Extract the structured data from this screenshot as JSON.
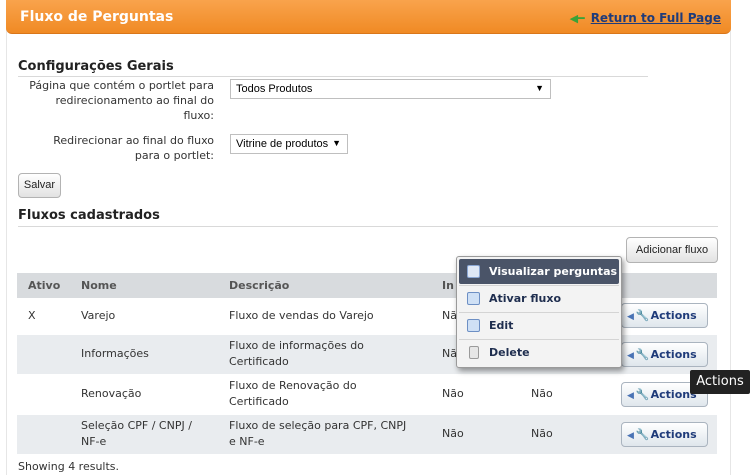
{
  "header": {
    "title": "Fluxo de Perguntas",
    "back_link": "Return to Full Page",
    "back_icon": "green-arrow-left-icon"
  },
  "general": {
    "title": "Configurações Gerais",
    "field1_label_lines": [
      "Página que contém o portlet para",
      "redirecionamento ao final do",
      "fluxo:"
    ],
    "field1_value": "Todos Produtos",
    "field2_label_lines": [
      "Redirecionar ao final do fluxo",
      "para o portlet:"
    ],
    "field2_value": "Vitrine de produtos",
    "save_label": "Salvar"
  },
  "flows": {
    "title": "Fluxos cadastrados",
    "add_label": "Adicionar fluxo",
    "columns": [
      "Ativo",
      "Nome",
      "Descrição",
      "In",
      ""
    ],
    "rows": [
      {
        "ativo": "X",
        "nome": [
          "Varejo"
        ],
        "descricao": [
          "Fluxo de vendas do Varejo"
        ],
        "c4": "Não",
        "c5": "",
        "action": "Actions"
      },
      {
        "ativo": "",
        "nome": [
          "Informações"
        ],
        "descricao": [
          "Fluxo de informações do",
          "Certificado"
        ],
        "c4": "Não",
        "c5": "",
        "action": "Actions"
      },
      {
        "ativo": "",
        "nome": [
          "Renovação"
        ],
        "descricao": [
          "Fluxo de Renovação do",
          "Certificado"
        ],
        "c4": "Não",
        "c5": "Não",
        "action": "Actions"
      },
      {
        "ativo": "",
        "nome": [
          "Seleção CPF / CNPJ /",
          "NF-e"
        ],
        "descricao": [
          "Fluxo de seleção para CPF, CNPJ",
          "e NF-e"
        ],
        "c4": "Não",
        "c5": "Não",
        "action": "Actions"
      }
    ],
    "results_text": "Showing 4 results."
  },
  "menu": {
    "items": [
      {
        "label": "Visualizar perguntas",
        "icon": "view-questions-icon",
        "active": true
      },
      {
        "label": "Ativar fluxo",
        "icon": "activate-icon",
        "active": false
      },
      {
        "label": "Edit",
        "icon": "edit-icon",
        "active": false
      },
      {
        "label": "Delete",
        "icon": "trash-icon",
        "active": false
      }
    ]
  },
  "tooltip": "Actions",
  "colors": {
    "header_orange": "#f08a24",
    "link_blue": "#1f3b7a",
    "menu_active": "#4a5468"
  }
}
